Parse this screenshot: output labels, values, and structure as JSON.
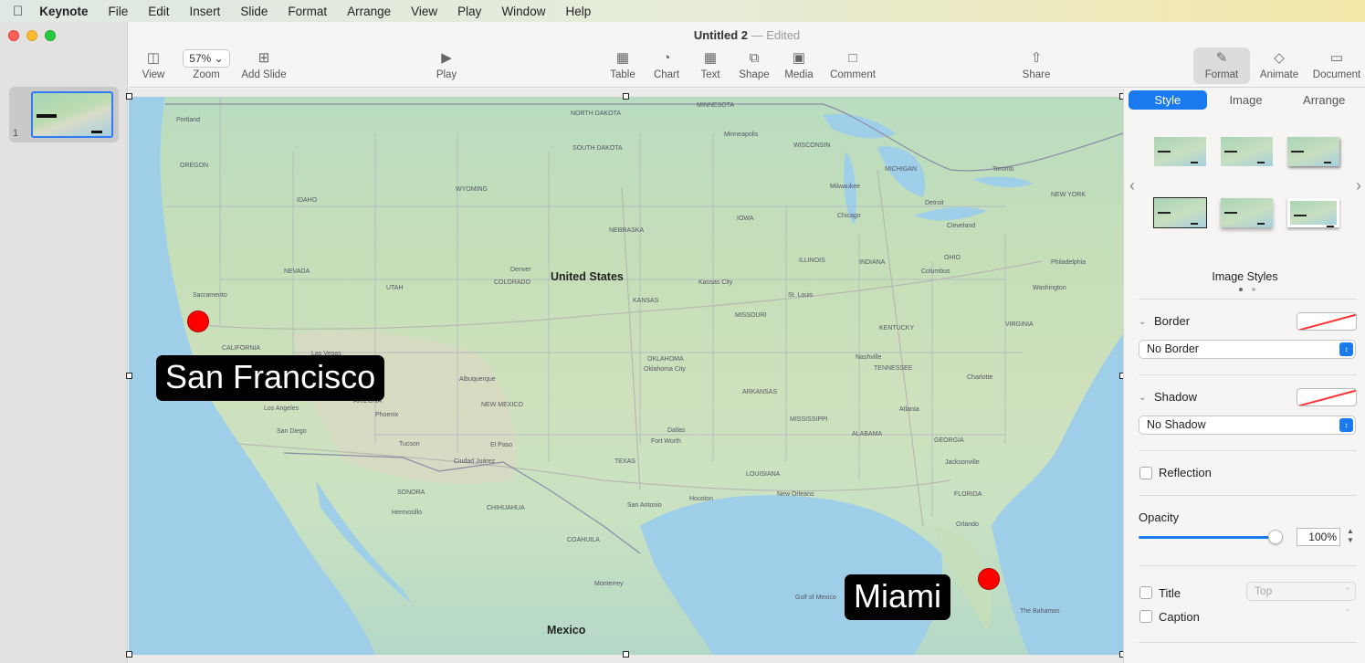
{
  "menubar": {
    "apple_icon": "",
    "app_name": "Keynote",
    "items": [
      "File",
      "Edit",
      "Insert",
      "Slide",
      "Format",
      "Arrange",
      "View",
      "Play",
      "Window",
      "Help"
    ]
  },
  "window": {
    "title": "Untitled 2",
    "title_sep": "—",
    "title_status": "Edited"
  },
  "sidebar": {
    "slide_number": "1"
  },
  "toolbar": {
    "view_label": "View",
    "zoom_value": "57%",
    "zoom_label": "Zoom",
    "add_slide_label": "Add Slide",
    "play_label": "Play",
    "table_label": "Table",
    "chart_label": "Chart",
    "text_label": "Text",
    "shape_label": "Shape",
    "media_label": "Media",
    "comment_label": "Comment",
    "share_label": "Share",
    "format_label": "Format",
    "animate_label": "Animate",
    "document_label": "Document"
  },
  "slide": {
    "callout_sf": "San Francisco",
    "callout_miami": "Miami",
    "map_labels": {
      "us": "United States",
      "mexico": "Mexico",
      "portland": "Portland",
      "sacramento": "Sacramento",
      "nevada": "NEVADA",
      "utah": "UTAH",
      "colorado": "COLORADO",
      "denver": "Denver",
      "wyoming": "WYOMING",
      "nebraska": "NEBRASKA",
      "kansas": "KANSAS",
      "kansas_city": "Kansas City",
      "minnesota": "MINNESOTA",
      "minneapolis": "Minneapolis",
      "wisconsin": "WISCONSIN",
      "michigan": "MICHIGAN",
      "chicago": "Chicago",
      "illinois": "ILLINOIS",
      "iowa": "IOWA",
      "missouri": "MISSOURI",
      "st_louis": "St. Louis",
      "ohio": "OHIO",
      "detroit": "Detroit",
      "toronto": "Toronto",
      "new_york": "NEW YORK",
      "philadelphia": "Philadelphia",
      "washington": "Washington",
      "kentucky": "KENTUCKY",
      "tennessee": "TENNESSEE",
      "nashville": "Nashville",
      "arkansas": "ARKANSAS",
      "oklahoma": "OKLAHOMA",
      "texas": "TEXAS",
      "dallas": "Dallas",
      "houston": "Houston",
      "san_antonio": "San Antonio",
      "new_mexico": "NEW MEXICO",
      "albuquerque": "Albuquerque",
      "arizona": "ARIZONA",
      "phoenix": "Phoenix",
      "las_vegas": "Las Vegas",
      "los_angeles": "Los Angeles",
      "san_diego": "San Diego",
      "california": "CALIFORNIA",
      "atlanta": "Atlanta",
      "georgia": "GEORGIA",
      "florida": "FLORIDA",
      "orlando": "Orlando",
      "jacksonville": "Jacksonville",
      "charlotte": "Charlotte",
      "mississippi": "MISSISSIPPI",
      "alabama": "ALABAMA",
      "louisiana": "LOUISIANA",
      "new_orleans": "New Orleans",
      "monterrey": "Monterrey",
      "chihuahua": "CHIHUAHUA",
      "sonora": "SONORA",
      "coahuila": "COAHUILA",
      "hermosillo": "Hermosillo",
      "tucson": "Tucson",
      "el_paso": "El Paso",
      "ciudad_juarez": "Ciudad Juárez",
      "the_bahamas": "The Bahamas",
      "gulf_of_mexico": "Gulf of Mexico",
      "south_dakota": "SOUTH DAKOTA",
      "north_dakota": "NORTH DAKOTA",
      "fort_worth": "Fort Worth",
      "oklahoma_city": "Oklahoma City",
      "milwaukee": "Milwaukee",
      "cleveland": "Cleveland",
      "columbus": "Columbus",
      "indiana": "INDIANA",
      "virginia": "VIRGINIA",
      "idaho": "IDAHO",
      "oregon": "OREGON"
    }
  },
  "inspector": {
    "tabs": [
      "Style",
      "Image",
      "Arrange"
    ],
    "image_styles_label": "Image Styles",
    "border_label": "Border",
    "border_value": "No Border",
    "shadow_label": "Shadow",
    "shadow_value": "No Shadow",
    "reflection_label": "Reflection",
    "opacity_label": "Opacity",
    "opacity_percent": 100,
    "opacity_value": "100%",
    "title_label": "Title",
    "title_position": "Top",
    "caption_label": "Caption",
    "accent_color": "#1a7bf0"
  }
}
